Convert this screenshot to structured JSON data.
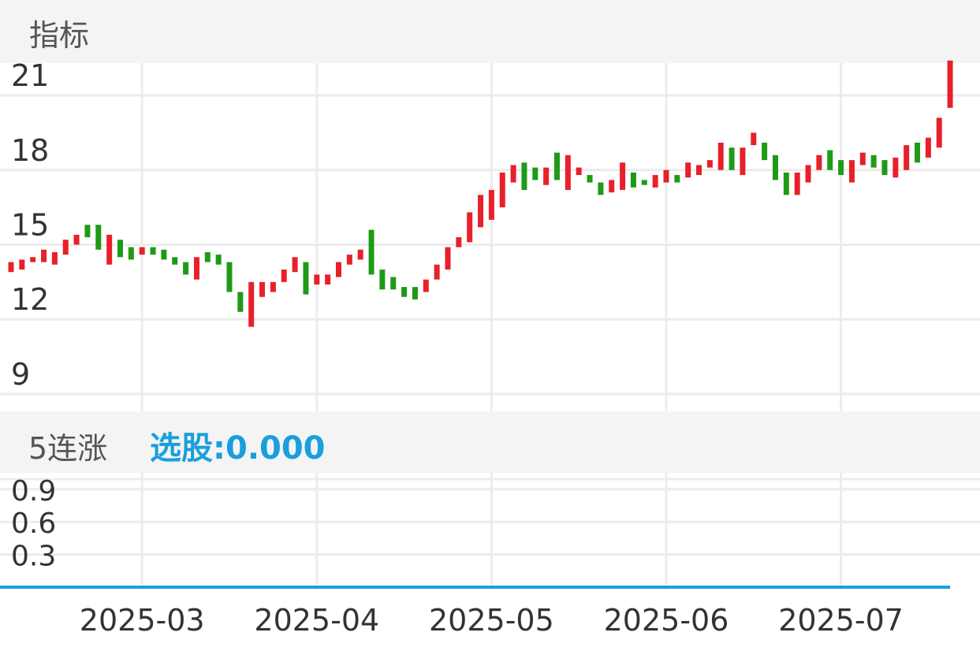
{
  "header": {
    "title": "指标"
  },
  "indicator": {
    "name": "5连涨",
    "value_label": "选股:0.000"
  },
  "colors": {
    "up": "#e8202a",
    "down": "#1f9a16",
    "indicator_line": "#1a9fdc",
    "grid": "#ececec"
  },
  "chart_data": [
    {
      "type": "candlestick",
      "y_ticks": [
        "21",
        "18",
        "15",
        "12",
        "9"
      ],
      "y_tick_values": [
        21,
        18,
        15,
        12,
        9
      ],
      "ylim": [
        8.3,
        22.3
      ],
      "x_ticks": [
        "2025-03",
        "2025-04",
        "2025-05",
        "2025-06",
        "2025-07"
      ],
      "x_tick_index": [
        12,
        28,
        44,
        60,
        76
      ],
      "candles": [
        {
          "o": 13.9,
          "c": 14.3,
          "d": "up"
        },
        {
          "o": 14.0,
          "c": 14.4,
          "d": "up"
        },
        {
          "o": 14.3,
          "c": 14.5,
          "d": "up"
        },
        {
          "o": 14.3,
          "c": 14.8,
          "d": "up"
        },
        {
          "o": 14.2,
          "c": 14.7,
          "d": "up"
        },
        {
          "o": 14.6,
          "c": 15.2,
          "d": "up"
        },
        {
          "o": 15.0,
          "c": 15.4,
          "d": "up"
        },
        {
          "o": 15.8,
          "c": 15.3,
          "d": "down"
        },
        {
          "o": 15.8,
          "c": 14.8,
          "d": "down"
        },
        {
          "o": 14.2,
          "c": 15.4,
          "d": "up"
        },
        {
          "o": 15.2,
          "c": 14.5,
          "d": "down"
        },
        {
          "o": 14.9,
          "c": 14.4,
          "d": "down"
        },
        {
          "o": 14.6,
          "c": 14.9,
          "d": "up"
        },
        {
          "o": 14.9,
          "c": 14.6,
          "d": "down"
        },
        {
          "o": 14.8,
          "c": 14.4,
          "d": "down"
        },
        {
          "o": 14.5,
          "c": 14.2,
          "d": "down"
        },
        {
          "o": 14.3,
          "c": 13.8,
          "d": "down"
        },
        {
          "o": 13.6,
          "c": 14.5,
          "d": "up"
        },
        {
          "o": 14.7,
          "c": 14.3,
          "d": "down"
        },
        {
          "o": 14.6,
          "c": 14.2,
          "d": "down"
        },
        {
          "o": 14.3,
          "c": 13.1,
          "d": "down"
        },
        {
          "o": 13.1,
          "c": 12.3,
          "d": "down"
        },
        {
          "o": 11.7,
          "c": 13.5,
          "d": "up"
        },
        {
          "o": 12.9,
          "c": 13.5,
          "d": "up"
        },
        {
          "o": 13.1,
          "c": 13.5,
          "d": "up"
        },
        {
          "o": 13.5,
          "c": 14.0,
          "d": "up"
        },
        {
          "o": 13.9,
          "c": 14.5,
          "d": "up"
        },
        {
          "o": 14.3,
          "c": 13.0,
          "d": "down"
        },
        {
          "o": 13.4,
          "c": 13.8,
          "d": "up"
        },
        {
          "o": 13.4,
          "c": 13.8,
          "d": "up"
        },
        {
          "o": 13.7,
          "c": 14.3,
          "d": "up"
        },
        {
          "o": 14.2,
          "c": 14.6,
          "d": "up"
        },
        {
          "o": 14.4,
          "c": 14.8,
          "d": "up"
        },
        {
          "o": 15.6,
          "c": 13.8,
          "d": "down"
        },
        {
          "o": 14.0,
          "c": 13.2,
          "d": "down"
        },
        {
          "o": 13.7,
          "c": 13.2,
          "d": "down"
        },
        {
          "o": 13.3,
          "c": 12.9,
          "d": "down"
        },
        {
          "o": 13.3,
          "c": 12.8,
          "d": "down"
        },
        {
          "o": 13.1,
          "c": 13.6,
          "d": "up"
        },
        {
          "o": 13.6,
          "c": 14.2,
          "d": "up"
        },
        {
          "o": 14.0,
          "c": 14.9,
          "d": "up"
        },
        {
          "o": 14.9,
          "c": 15.3,
          "d": "up"
        },
        {
          "o": 15.1,
          "c": 16.3,
          "d": "up"
        },
        {
          "o": 15.7,
          "c": 17.0,
          "d": "up"
        },
        {
          "o": 16.0,
          "c": 17.2,
          "d": "up"
        },
        {
          "o": 16.5,
          "c": 17.9,
          "d": "up"
        },
        {
          "o": 17.5,
          "c": 18.2,
          "d": "up"
        },
        {
          "o": 18.3,
          "c": 17.2,
          "d": "down"
        },
        {
          "o": 18.1,
          "c": 17.6,
          "d": "down"
        },
        {
          "o": 17.4,
          "c": 18.1,
          "d": "up"
        },
        {
          "o": 18.7,
          "c": 17.6,
          "d": "down"
        },
        {
          "o": 17.2,
          "c": 18.6,
          "d": "up"
        },
        {
          "o": 17.8,
          "c": 18.1,
          "d": "up"
        },
        {
          "o": 17.8,
          "c": 17.5,
          "d": "down"
        },
        {
          "o": 17.5,
          "c": 17.0,
          "d": "down"
        },
        {
          "o": 17.1,
          "c": 17.6,
          "d": "up"
        },
        {
          "o": 17.2,
          "c": 18.3,
          "d": "up"
        },
        {
          "o": 17.9,
          "c": 17.3,
          "d": "down"
        },
        {
          "o": 17.6,
          "c": 17.4,
          "d": "down"
        },
        {
          "o": 17.3,
          "c": 17.8,
          "d": "up"
        },
        {
          "o": 17.5,
          "c": 18.0,
          "d": "up"
        },
        {
          "o": 17.8,
          "c": 17.5,
          "d": "down"
        },
        {
          "o": 17.7,
          "c": 18.3,
          "d": "up"
        },
        {
          "o": 17.8,
          "c": 18.2,
          "d": "up"
        },
        {
          "o": 18.1,
          "c": 18.4,
          "d": "up"
        },
        {
          "o": 18.0,
          "c": 19.1,
          "d": "up"
        },
        {
          "o": 18.9,
          "c": 18.0,
          "d": "down"
        },
        {
          "o": 17.8,
          "c": 18.9,
          "d": "up"
        },
        {
          "o": 19.0,
          "c": 19.5,
          "d": "up"
        },
        {
          "o": 19.1,
          "c": 18.4,
          "d": "down"
        },
        {
          "o": 18.6,
          "c": 17.6,
          "d": "down"
        },
        {
          "o": 17.9,
          "c": 17.0,
          "d": "down"
        },
        {
          "o": 17.0,
          "c": 17.9,
          "d": "up"
        },
        {
          "o": 17.5,
          "c": 18.2,
          "d": "up"
        },
        {
          "o": 18.0,
          "c": 18.6,
          "d": "up"
        },
        {
          "o": 18.8,
          "c": 18.0,
          "d": "down"
        },
        {
          "o": 18.4,
          "c": 17.8,
          "d": "down"
        },
        {
          "o": 17.5,
          "c": 18.4,
          "d": "up"
        },
        {
          "o": 18.2,
          "c": 18.7,
          "d": "up"
        },
        {
          "o": 18.6,
          "c": 18.1,
          "d": "down"
        },
        {
          "o": 18.4,
          "c": 17.8,
          "d": "down"
        },
        {
          "o": 17.7,
          "c": 18.5,
          "d": "up"
        },
        {
          "o": 18.0,
          "c": 19.0,
          "d": "up"
        },
        {
          "o": 19.1,
          "c": 18.3,
          "d": "down"
        },
        {
          "o": 18.5,
          "c": 19.3,
          "d": "up"
        },
        {
          "o": 18.9,
          "c": 20.1,
          "d": "up"
        },
        {
          "o": 20.5,
          "c": 22.4,
          "d": "up"
        }
      ]
    },
    {
      "type": "line",
      "name": "选股",
      "y_ticks": [
        "0.9",
        "0.6",
        "0.3"
      ],
      "y_tick_values": [
        0.9,
        0.6,
        0.3
      ],
      "ylim": [
        0,
        1.0
      ],
      "values_constant": 0
    }
  ]
}
